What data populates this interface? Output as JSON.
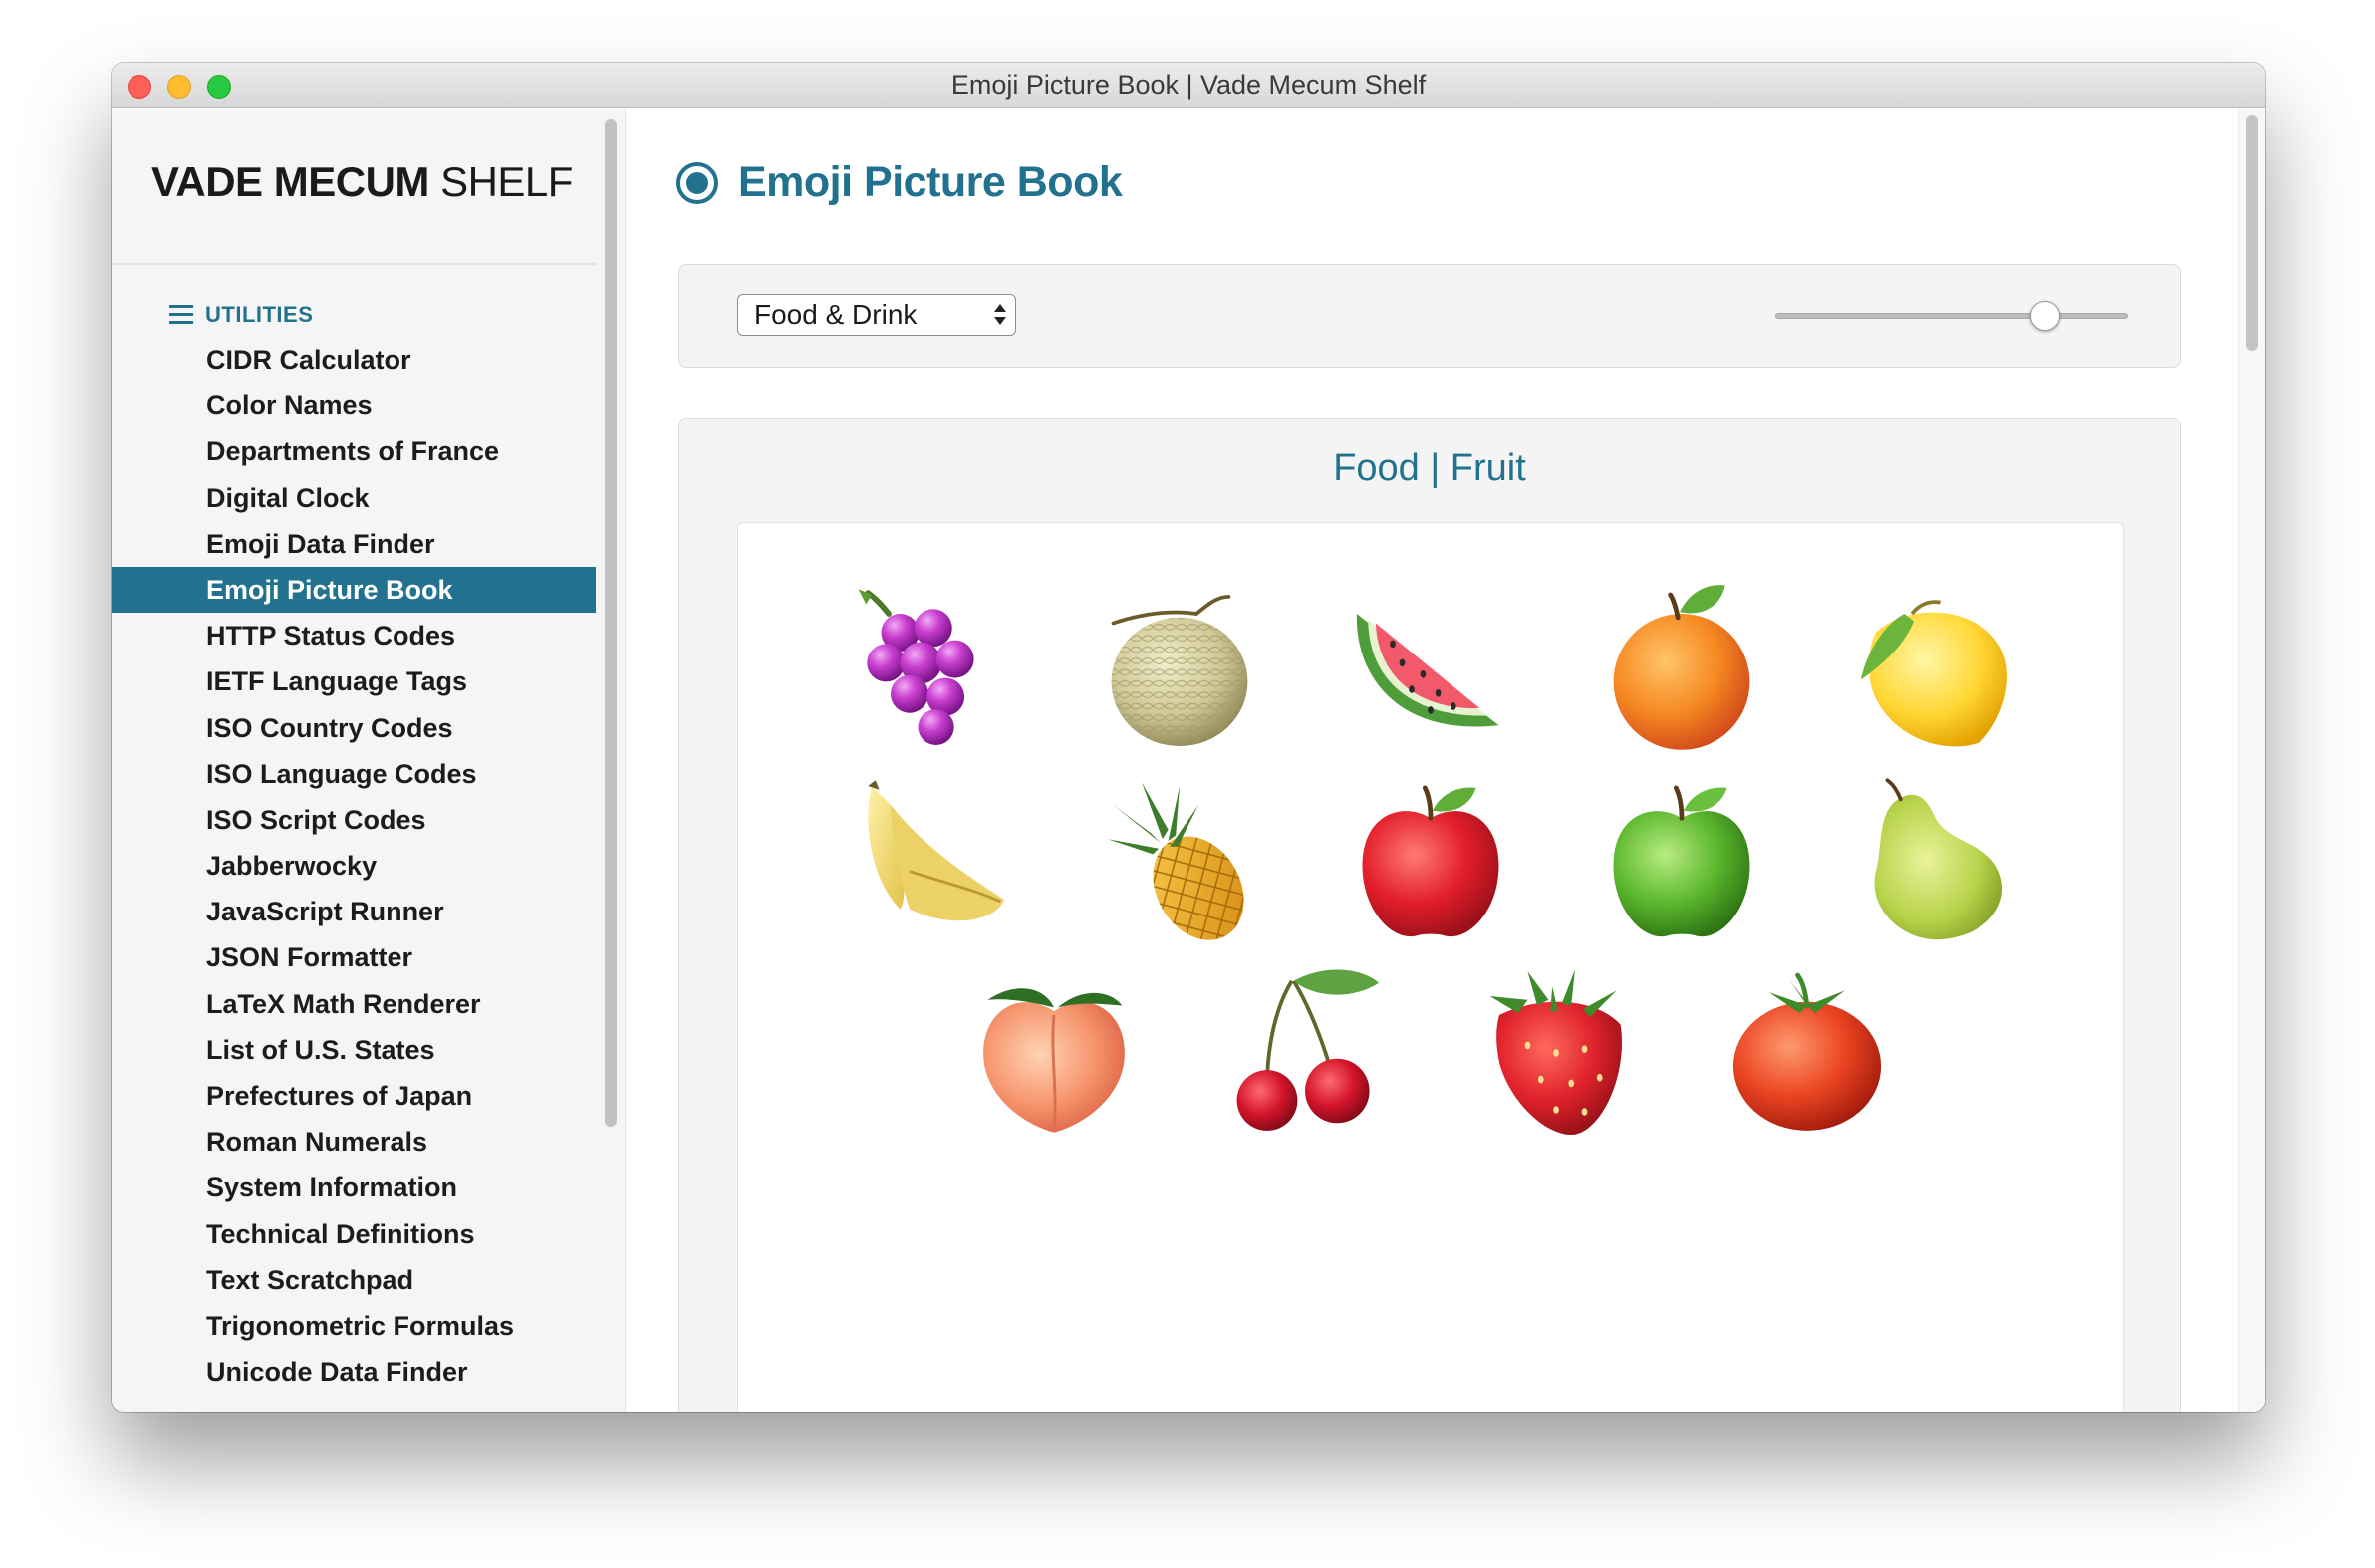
{
  "window": {
    "title": "Emoji Picture Book | Vade Mecum Shelf"
  },
  "sidebar": {
    "brand_bold": "VADE MECUM",
    "brand_light": "SHELF",
    "section_label": "UTILITIES",
    "items": [
      {
        "label": "CIDR Calculator",
        "selected": false
      },
      {
        "label": "Color Names",
        "selected": false
      },
      {
        "label": "Departments of France",
        "selected": false
      },
      {
        "label": "Digital Clock",
        "selected": false
      },
      {
        "label": "Emoji Data Finder",
        "selected": false
      },
      {
        "label": "Emoji Picture Book",
        "selected": true
      },
      {
        "label": "HTTP Status Codes",
        "selected": false
      },
      {
        "label": "IETF Language Tags",
        "selected": false
      },
      {
        "label": "ISO Country Codes",
        "selected": false
      },
      {
        "label": "ISO Language Codes",
        "selected": false
      },
      {
        "label": "ISO Script Codes",
        "selected": false
      },
      {
        "label": "Jabberwocky",
        "selected": false
      },
      {
        "label": "JavaScript Runner",
        "selected": false
      },
      {
        "label": "JSON Formatter",
        "selected": false
      },
      {
        "label": "LaTeX Math Renderer",
        "selected": false
      },
      {
        "label": "List of U.S. States",
        "selected": false
      },
      {
        "label": "Prefectures of Japan",
        "selected": false
      },
      {
        "label": "Roman Numerals",
        "selected": false
      },
      {
        "label": "System Information",
        "selected": false
      },
      {
        "label": "Technical Definitions",
        "selected": false
      },
      {
        "label": "Text Scratchpad",
        "selected": false
      },
      {
        "label": "Trigonometric Formulas",
        "selected": false
      },
      {
        "label": "Unicode Data Finder",
        "selected": false
      }
    ]
  },
  "main": {
    "title": "Emoji Picture Book",
    "category_select": {
      "value": "Food & Drink"
    },
    "size_slider": {
      "value": 0.79
    },
    "group": {
      "title": "Food | Fruit",
      "emoji_rows": [
        [
          "grapes",
          "melon",
          "watermelon",
          "tangerine",
          "lemon"
        ],
        [
          "banana",
          "pineapple",
          "red-apple",
          "green-apple",
          "pear"
        ],
        [
          "peach",
          "cherries",
          "strawberry",
          "tomato"
        ]
      ]
    }
  },
  "colors": {
    "accent": "#22718f",
    "sidebar_background": "#f5f5f5",
    "panel_background": "#f4f4f4"
  }
}
